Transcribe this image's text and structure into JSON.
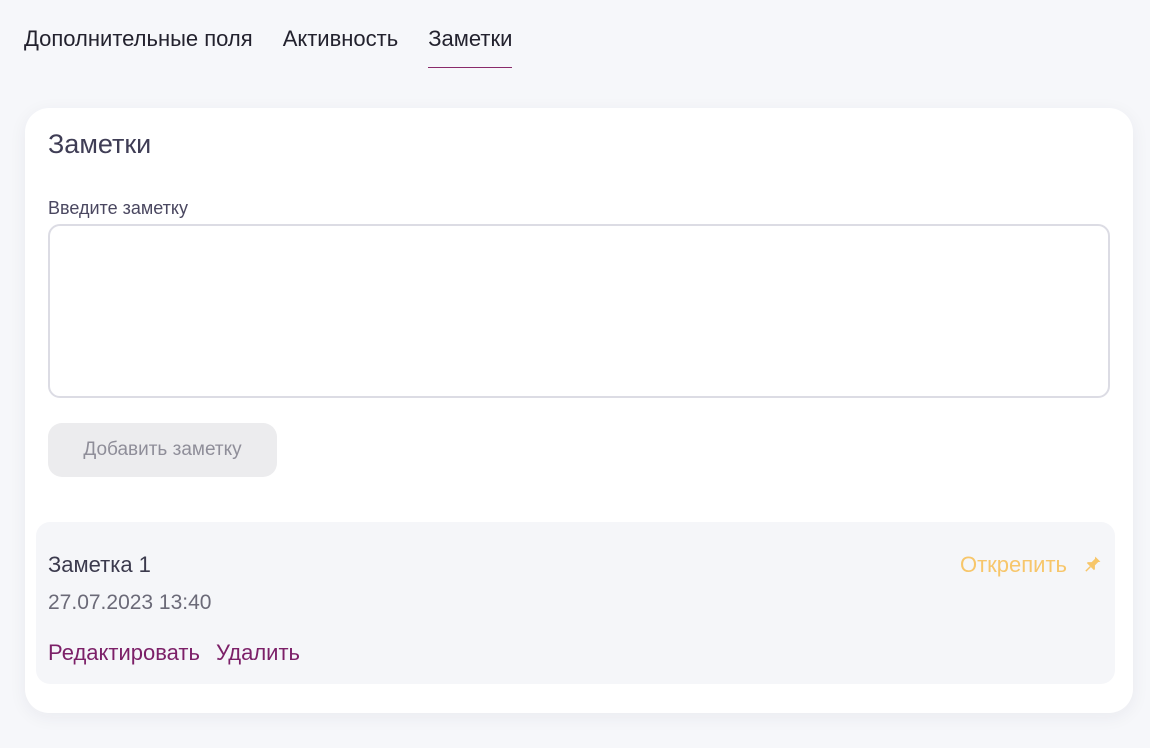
{
  "tabs": [
    {
      "label": "Дополнительные поля",
      "active": false
    },
    {
      "label": "Активность",
      "active": false
    },
    {
      "label": "Заметки",
      "active": true
    }
  ],
  "notes_card": {
    "title": "Заметки",
    "input_label": "Введите заметку",
    "input_value": "",
    "add_button_label": "Добавить заметку"
  },
  "notes": [
    {
      "title": "Заметка 1",
      "date": "27.07.2023 13:40",
      "unpin_label": "Открепить",
      "pin_icon": "pin-icon",
      "edit_label": "Редактировать",
      "delete_label": "Удалить"
    }
  ],
  "colors": {
    "accent": "#7c2068",
    "tab_underline": "#8a2a6a",
    "unpin": "#f7c66a",
    "background": "#f6f7fa"
  }
}
